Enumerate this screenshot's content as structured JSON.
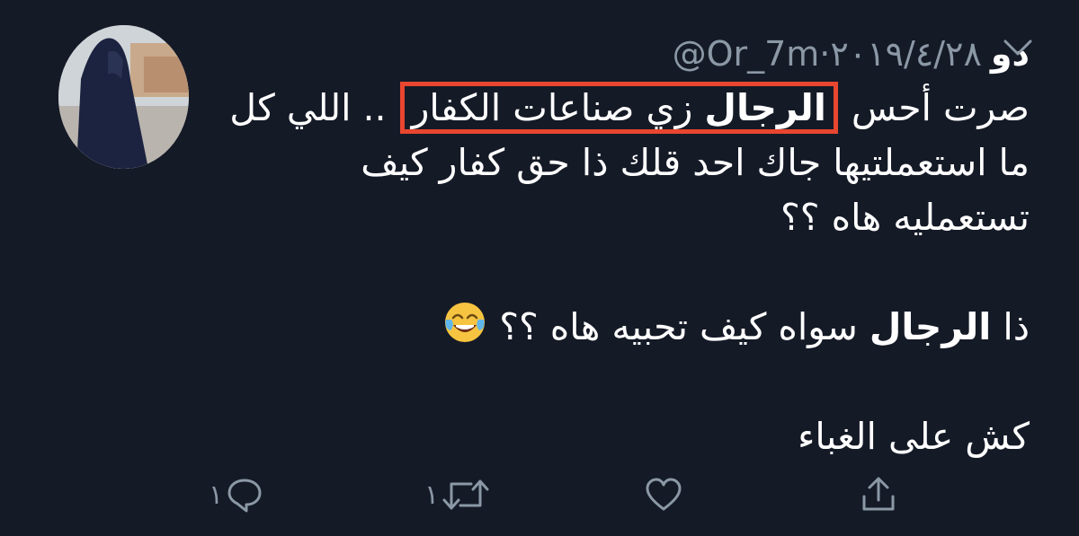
{
  "tweet": {
    "display_name": "دو",
    "handle": "@Or_7m",
    "separator": "·",
    "date": "٢٠١٩/٤/٢٨",
    "lines": {
      "l1_before": "صرت أحس ",
      "l1_bold": "الرجال",
      "l1_rest": " زي صناعات الكفار",
      "l1_after": " .. اللي كل",
      "l2": "ما استعملتيها جاك احد قلك ذا حق كفار كيف",
      "l3": "تستعمليه هاه ؟؟",
      "l4_before": "ذا ",
      "l4_bold": "الرجال",
      "l4_after": " سواه كيف تحبيه هاه ؟؟ ",
      "l5": "كش على الغباء"
    },
    "emoji": "face-with-tears-of-joy-emoji"
  },
  "actions": {
    "reply_count": "١",
    "retweet_count": "١"
  },
  "colors": {
    "background": "#151a27",
    "muted": "#8b98a5",
    "highlight_border": "#e8462f"
  },
  "icons": [
    "chevron-down-icon",
    "reply-icon",
    "retweet-icon",
    "like-icon",
    "share-icon"
  ]
}
